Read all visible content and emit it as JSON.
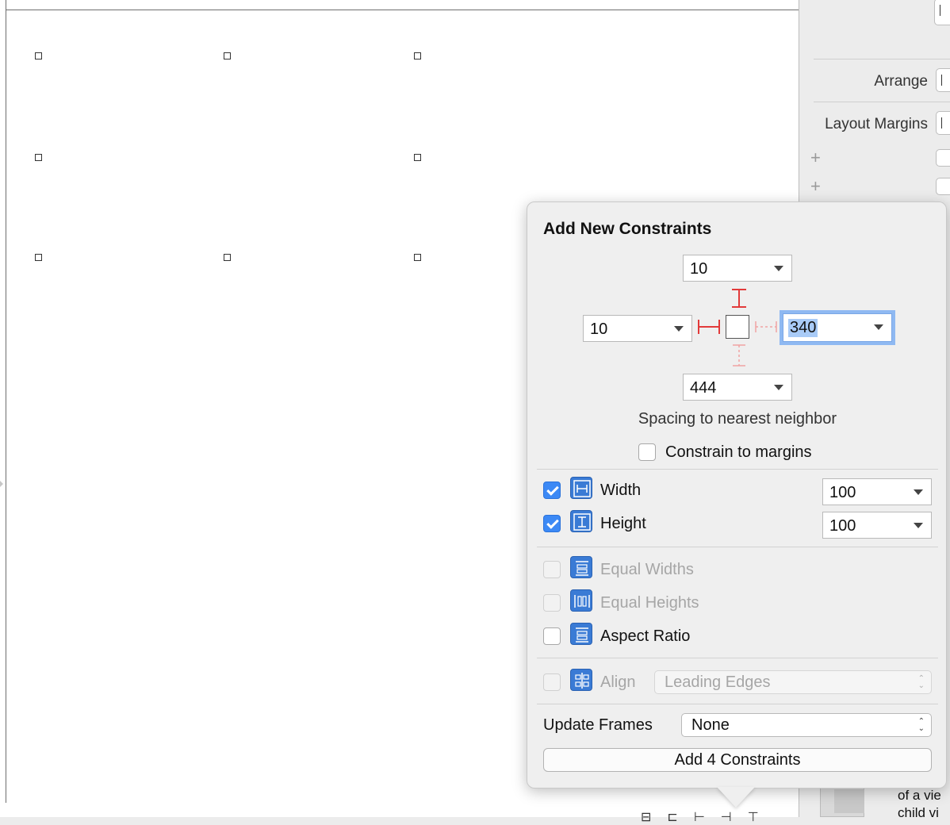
{
  "inspector": {
    "arrange_label": "Arrange",
    "layout_margins_label": "Layout Margins",
    "plus_1": "+",
    "plus_2": "+",
    "desc_line1": "of a vie",
    "desc_line2": "child vi"
  },
  "popover": {
    "title": "Add New Constraints",
    "spacing": {
      "top": "10",
      "left": "10",
      "right": "340",
      "bottom": "444"
    },
    "spacing_caption": "Spacing to nearest neighbor",
    "constrain_to_margins": {
      "label": "Constrain to margins",
      "checked": false
    },
    "width": {
      "label": "Width",
      "value": "100",
      "checked": true
    },
    "height": {
      "label": "Height",
      "value": "100",
      "checked": true
    },
    "equal_widths": {
      "label": "Equal Widths",
      "checked": false,
      "enabled": false
    },
    "equal_heights": {
      "label": "Equal Heights",
      "checked": false,
      "enabled": false
    },
    "aspect_ratio": {
      "label": "Aspect Ratio",
      "checked": false,
      "enabled": true
    },
    "align": {
      "label": "Align",
      "value": "Leading Edges",
      "enabled": false
    },
    "update_frames": {
      "label": "Update Frames",
      "value": "None"
    },
    "add_button": "Add 4 Constraints"
  },
  "colors": {
    "accent": "#3c89f5",
    "constraint_red": "#e23a3a",
    "constraint_pink": "#f0a3a3",
    "focus_ring": "#8fb9f2"
  },
  "icons": [
    "width-constraint-icon",
    "height-constraint-icon",
    "equal-widths-icon",
    "equal-heights-icon",
    "aspect-ratio-icon",
    "align-icon"
  ]
}
